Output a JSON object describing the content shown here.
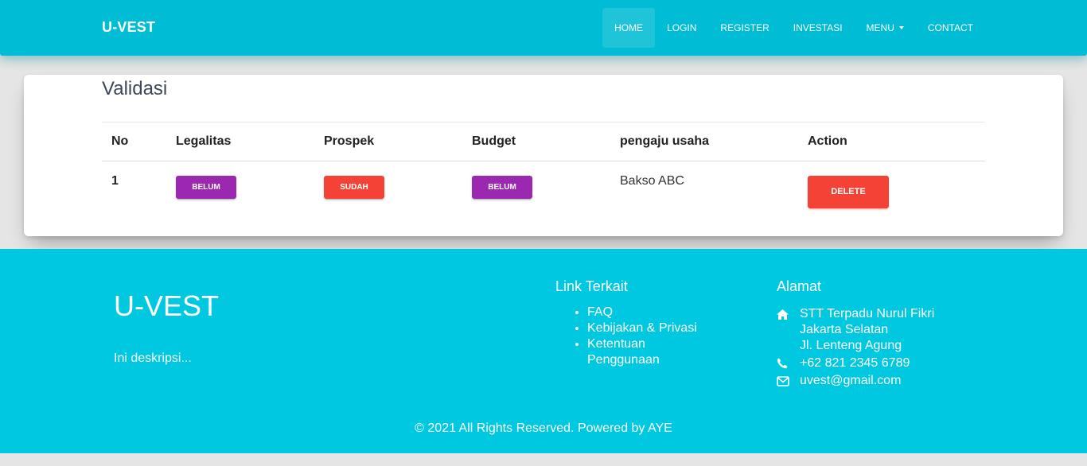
{
  "navbar": {
    "brand": "U-VEST",
    "items": [
      {
        "label": "HOME",
        "active": true
      },
      {
        "label": "LOGIN"
      },
      {
        "label": "REGISTER"
      },
      {
        "label": "INVESTASI"
      },
      {
        "label": "MENU",
        "dropdown": true
      },
      {
        "label": "CONTACT"
      }
    ]
  },
  "card": {
    "title": "Validasi",
    "table": {
      "headers": [
        "No",
        "Legalitas",
        "Prospek",
        "Budget",
        "pengaju usaha",
        "Action"
      ],
      "rows": [
        {
          "no": "1",
          "legalitas": "BELUM",
          "prospek": "SUDAH",
          "budget": "BELUM",
          "pengaju": "Bakso ABC",
          "action": "DELETE"
        }
      ]
    }
  },
  "footer": {
    "brand": "U-VEST",
    "description": "Ini deskripsi...",
    "links_title": "Link Terkait",
    "links": [
      "FAQ",
      "Kebijakan & Privasi",
      "Ketentuan Penggunaan"
    ],
    "address_title": "Alamat",
    "address": {
      "lines": [
        "STT Terpadu Nurul Fikri",
        "Jakarta Selatan",
        "Jl. Lenteng Agung"
      ],
      "phone": "+62 821 2345 6789",
      "email": "uvest@gmail.com"
    },
    "copyright": "© 2021 All Rights Reserved. Powered by AYE"
  },
  "colors": {
    "navbar": "#00bcd4",
    "footer": "#00c8e0",
    "status_belum": "#9c27b0",
    "status_sudah": "#f44336",
    "delete": "#f44336"
  },
  "icons": [
    "home-icon",
    "phone-icon",
    "envelope-icon",
    "caret-down-icon"
  ]
}
